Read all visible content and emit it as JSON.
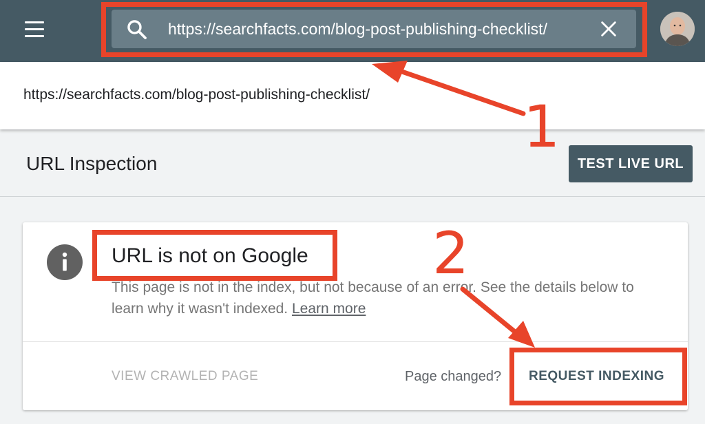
{
  "header": {
    "search_value": "https://searchfacts.com/blog-post-publishing-checklist/",
    "menu_icon": "hamburger-menu-icon",
    "search_icon": "search-icon",
    "clear_icon": "close-icon",
    "avatar_icon": "user-avatar"
  },
  "url_bar": {
    "url": "https://searchfacts.com/blog-post-publishing-checklist/"
  },
  "page": {
    "title": "URL Inspection",
    "test_live_url_label": "TEST LIVE URL"
  },
  "status_card": {
    "icon": "info-icon",
    "title": "URL is not on Google",
    "description": "This page is not in the index, but not because of an error. See the details below to learn why it wasn't indexed.",
    "learn_more": "Learn more",
    "view_crawled_label": "VIEW CRAWLED PAGE",
    "page_changed_text": "Page changed?",
    "request_indexing_label": "REQUEST INDEXING"
  },
  "annotations": {
    "marker_1": "1",
    "marker_2": "2",
    "color": "#e8442a"
  },
  "colors": {
    "topbar": "#455a64",
    "searchbox": "#6a7e88",
    "button": "#455a64"
  }
}
